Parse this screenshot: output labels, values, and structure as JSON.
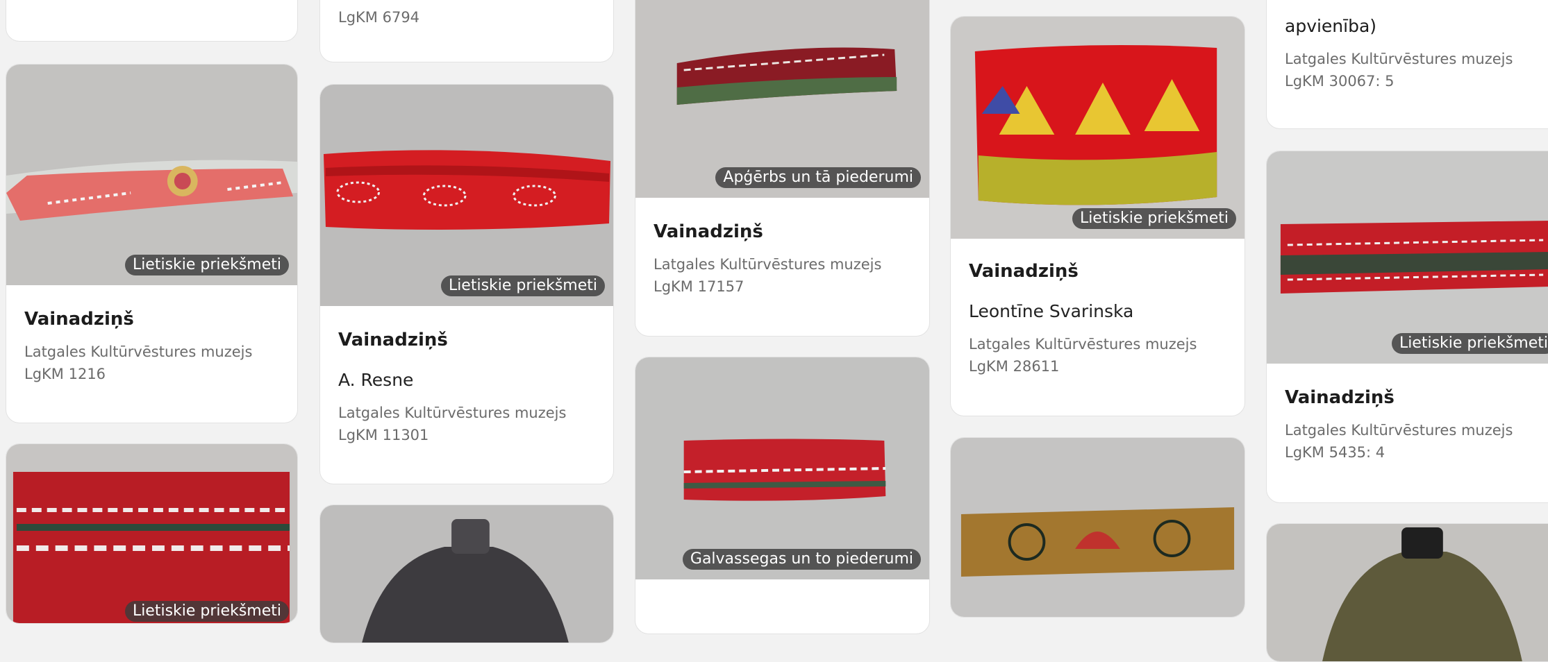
{
  "colors": {
    "accent_red": "#c81d25",
    "badge_bg": "#3c3c3c",
    "card_bg": "#ffffff",
    "page_bg": "#f2f2f2"
  },
  "cards": [
    {
      "name": "card-col2-top-partial",
      "accession": "LgKM 6794"
    },
    {
      "name": "card-col4-top-partial",
      "title_tail": "apvienība)",
      "museum": "Latgales Kultūrvēstures muzejs",
      "accession": "LgKM 30067: 5"
    },
    {
      "name": "card-1216",
      "category": "Lietiskie priekšmeti",
      "title": "Vainadziņš",
      "museum": "Latgales Kultūrvēstures muzejs",
      "accession": "LgKM 1216"
    },
    {
      "name": "card-11301",
      "category": "Lietiskie priekšmeti",
      "title": "Vainadziņš",
      "author": "A. Resne",
      "museum": "Latgales Kultūrvēstures muzejs",
      "accession": "LgKM 11301"
    },
    {
      "name": "card-17157",
      "category": "Apģērbs un tā piederumi",
      "title": "Vainadziņš",
      "museum": "Latgales Kultūrvēstures muzejs",
      "accession": "LgKM 17157"
    },
    {
      "name": "card-28611",
      "category": "Lietiskie priekšmeti",
      "title": "Vainadziņš",
      "author": "Leontīne Svarinska",
      "museum": "Latgales Kultūrvēstures muzejs",
      "accession": "LgKM 28611"
    },
    {
      "name": "card-5435",
      "category": "Lietiskie priekšmeti",
      "title": "Vainadziņš",
      "museum": "Latgales Kultūrvēstures muzejs",
      "accession": "LgKM 5435: 4"
    },
    {
      "name": "card-col1-bottom",
      "category": "Lietiskie priekšmeti"
    },
    {
      "name": "card-col3-bottom",
      "category": "Galvassegas un to piederumi"
    }
  ]
}
